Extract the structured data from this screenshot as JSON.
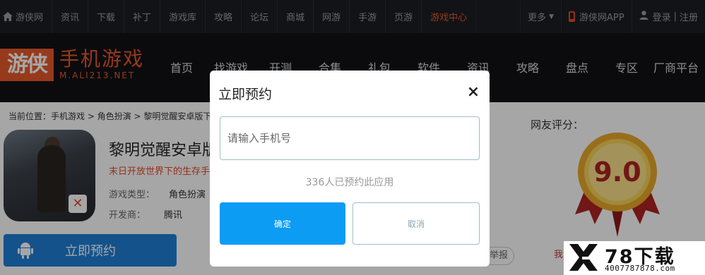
{
  "topbar": {
    "nav": [
      "游侠网",
      "资讯",
      "下载",
      "补丁",
      "游戏库",
      "攻略",
      "论坛",
      "商城",
      "网游",
      "手游",
      "页游",
      "游戏中心"
    ],
    "more": "更多",
    "app": "游侠网APP",
    "login": "登录",
    "divider": "|",
    "register": "注册",
    "active_color": "#e85a2a"
  },
  "header": {
    "logo_box": "游侠",
    "logo_main": "手机游戏",
    "logo_sub": "M.ALI213.NET",
    "nav": [
      "首页",
      "找游戏",
      "开测",
      "合集",
      "礼包",
      "软件",
      "资讯",
      "攻略",
      "盘点",
      "专区",
      "厂商平台"
    ]
  },
  "page": {
    "breadcrumb": "当前位置：手机游戏 > 角色扮演 > 黎明觉醒安卓版下载",
    "app_title": "黎明觉醒安卓版",
    "app_slogan": "末日开放世界下的生存手",
    "meta": [
      {
        "label": "游戏类型：",
        "value": "角色扮演"
      },
      {
        "label": "开发商：",
        "value": "腾讯"
      }
    ],
    "reserve_button": "立即预约",
    "rating_label": "网友评分：",
    "rating": "9.0",
    "report": "举报",
    "report_red": "我"
  },
  "modal": {
    "title": "立即预约",
    "close": "×",
    "phone_placeholder": "请输入手机号",
    "count_text": "336人已预约此应用",
    "ok": "确定",
    "cancel": "取消"
  },
  "watermark": {
    "brand": "78下载",
    "phone": "4007787878.com"
  },
  "colors": {
    "accent": "#e85a2a",
    "primary_button": "#0d9cf4",
    "reserve_button": "#1f7fd8"
  }
}
